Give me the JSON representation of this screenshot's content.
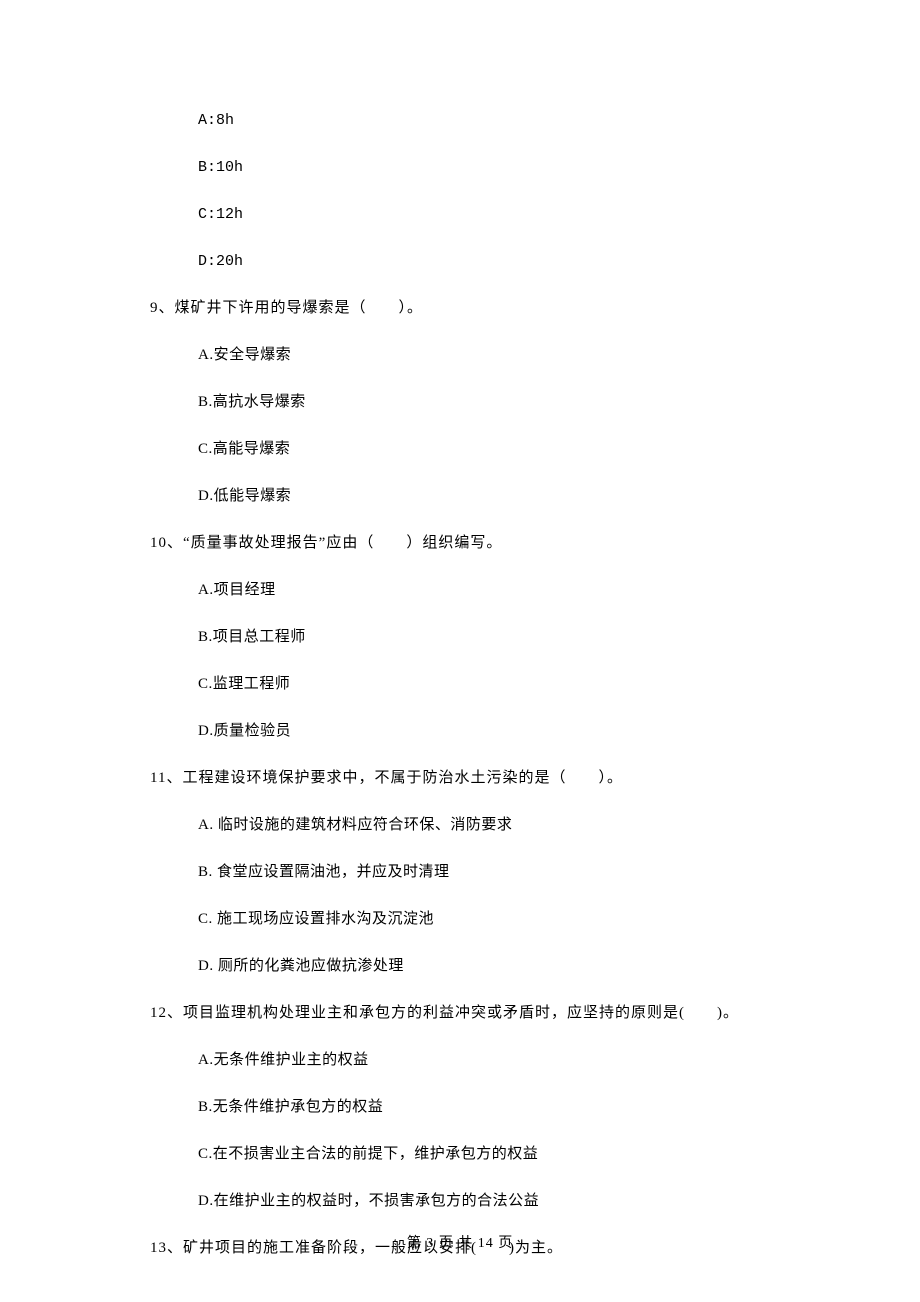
{
  "q8_remainder": {
    "optionA": "A:8h",
    "optionB": "B:10h",
    "optionC": "C:12h",
    "optionD": "D:20h"
  },
  "q9": {
    "stem": "9、煤矿井下许用的导爆索是（　　）。",
    "optionA": "A.安全导爆索",
    "optionB": "B.高抗水导爆索",
    "optionC": "C.高能导爆索",
    "optionD": "D.低能导爆索"
  },
  "q10": {
    "stem": "10、“质量事故处理报告”应由（　　）组织编写。",
    "optionA": "A.项目经理",
    "optionB": "B.项目总工程师",
    "optionC": "C.监理工程师",
    "optionD": "D.质量检验员"
  },
  "q11": {
    "stem": "11、工程建设环境保护要求中，不属于防治水土污染的是（　　）。",
    "optionA": "A.  临时设施的建筑材料应符合环保、消防要求",
    "optionB": "B.  食堂应设置隔油池，并应及时清理",
    "optionC": "C.  施工现场应设置排水沟及沉淀池",
    "optionD": "D.  厕所的化粪池应做抗渗处理"
  },
  "q12": {
    "stem": "12、项目监理机构处理业主和承包方的利益冲突或矛盾时，应坚持的原则是(　　)。",
    "optionA": "A.无条件维护业主的权益",
    "optionB": "B.无条件维护承包方的权益",
    "optionC": "C.在不损害业主合法的前提下，维护承包方的权益",
    "optionD": "D.在维护业主的权益时，不损害承包方的合法公益"
  },
  "q13": {
    "stem": "13、矿井项目的施工准备阶段，一般应以安排(　　)为主。"
  },
  "footer": "第 3 页 共 14 页"
}
